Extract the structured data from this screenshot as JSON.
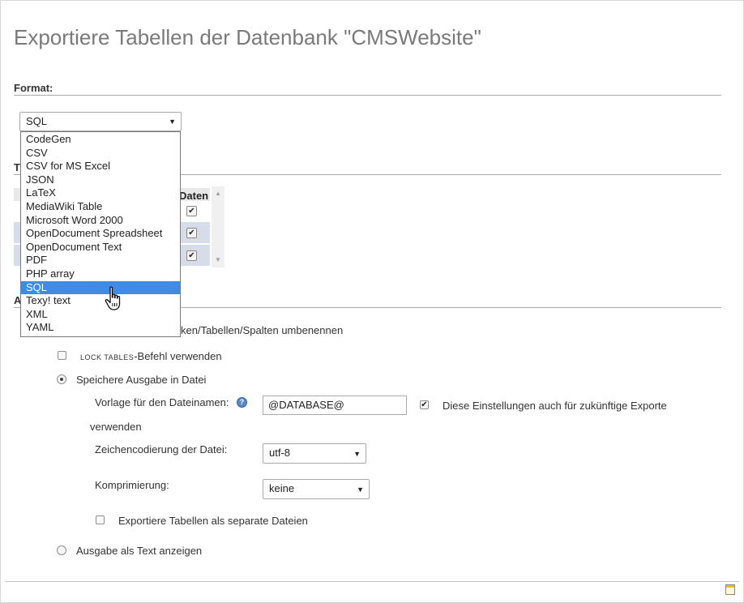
{
  "page": {
    "title": "Exportiere Tabellen der Datenbank \"CMSWebsite\""
  },
  "format": {
    "label": "Format:",
    "selected": "SQL",
    "options": [
      "CodeGen",
      "CSV",
      "CSV for MS Excel",
      "JSON",
      "LaTeX",
      "MediaWiki Table",
      "Microsoft Word 2000",
      "OpenDocument Spreadsheet",
      "OpenDocument Text",
      "PDF",
      "PHP array",
      "SQL",
      "Texy! text",
      "XML",
      "YAML"
    ],
    "highlighted_index": 11
  },
  "tables_section": {
    "label_fragment": "T",
    "column_daten": "Daten"
  },
  "output_section": {
    "label_fragment": "A",
    "rename_partial": "ken/Tabellen/Spalten umbenennen",
    "lock_tables_keyword": "LOCK TABLES",
    "lock_tables_suffix": "-Befehl verwenden",
    "save_to_file": "Speichere Ausgabe in Datei",
    "filename_template_label": "Vorlage für den Dateinamen:",
    "filename_template_value": "@DATABASE@",
    "remember_label_line1": "Diese Einstellungen auch für zukünftige Exporte",
    "remember_label_line2": "verwenden",
    "charset_label": "Zeichencodierung der Datei:",
    "charset_value": "utf-8",
    "compression_label": "Komprimierung:",
    "compression_value": "keine",
    "separate_files_label": "Exportiere Tabellen als separate Dateien",
    "show_as_text": "Ausgabe als Text anzeigen"
  },
  "icons": {
    "select_arrow": "▼",
    "check": "✔",
    "help": "?"
  }
}
